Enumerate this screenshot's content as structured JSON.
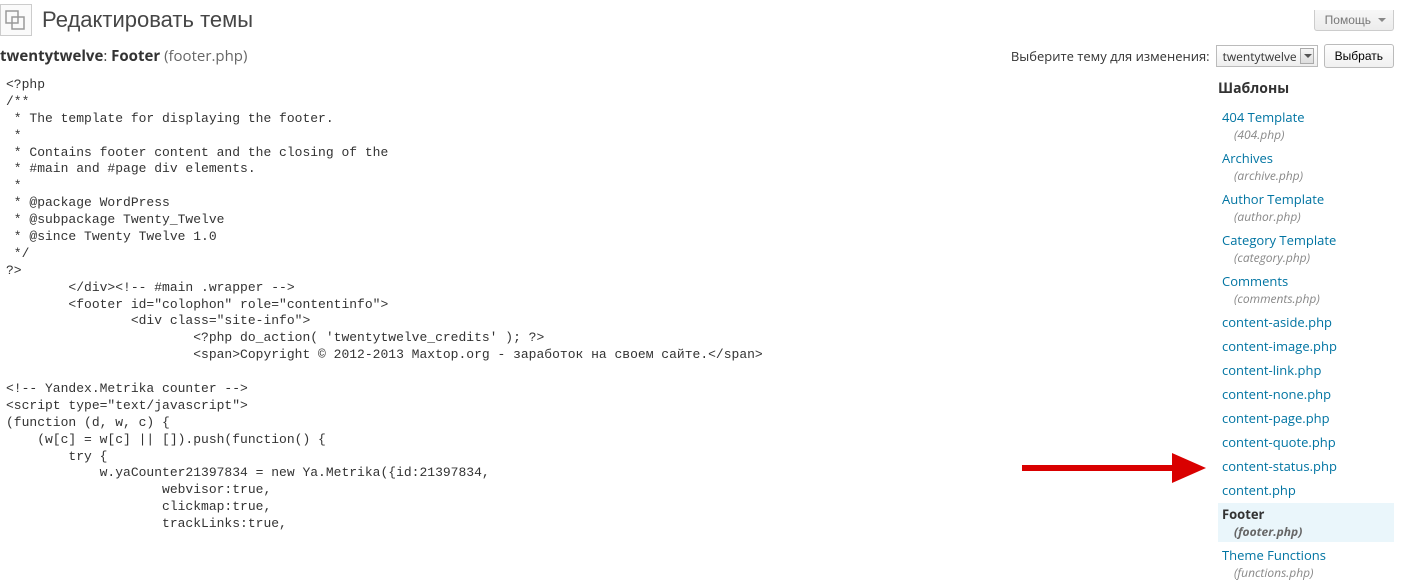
{
  "header": {
    "title": "Редактировать темы",
    "help_label": "Помощь"
  },
  "subheader": {
    "theme_name": "twentytwelve",
    "title_sep": ": ",
    "file_label": "Footer",
    "file_name": "(footer.php)"
  },
  "selector": {
    "label": "Выберите тему для изменения:",
    "selected": "twentytwelve",
    "button": "Выбрать"
  },
  "editor": {
    "content": "<?php\n/**\n * The template for displaying the footer.\n *\n * Contains footer content and the closing of the\n * #main and #page div elements.\n *\n * @package WordPress\n * @subpackage Twenty_Twelve\n * @since Twenty Twelve 1.0\n */\n?>\n        </div><!-- #main .wrapper -->\n        <footer id=\"colophon\" role=\"contentinfo\">\n                <div class=\"site-info\">\n                        <?php do_action( 'twentytwelve_credits' ); ?>\n                        <span>Copyright © 2012-2013 Maxtop.org - заработок на своем сайте.</span>\n\n<!-- Yandex.Metrika counter -->\n<script type=\"text/javascript\">\n(function (d, w, c) {\n    (w[c] = w[c] || []).push(function() {\n        try {\n            w.yaCounter21397834 = new Ya.Metrika({id:21397834,\n                    webvisor:true,\n                    clickmap:true,\n                    trackLinks:true,"
  },
  "sidebar": {
    "heading": "Шаблоны",
    "files": [
      {
        "label": "404 Template",
        "fname": "(404.php)",
        "active": false
      },
      {
        "label": "Archives",
        "fname": "(archive.php)",
        "active": false
      },
      {
        "label": "Author Template",
        "fname": "(author.php)",
        "active": false
      },
      {
        "label": "Category Template",
        "fname": "(category.php)",
        "active": false
      },
      {
        "label": "Comments",
        "fname": "(comments.php)",
        "active": false
      },
      {
        "label": "content-aside.php",
        "fname": "",
        "active": false
      },
      {
        "label": "content-image.php",
        "fname": "",
        "active": false
      },
      {
        "label": "content-link.php",
        "fname": "",
        "active": false
      },
      {
        "label": "content-none.php",
        "fname": "",
        "active": false
      },
      {
        "label": "content-page.php",
        "fname": "",
        "active": false
      },
      {
        "label": "content-quote.php",
        "fname": "",
        "active": false
      },
      {
        "label": "content-status.php",
        "fname": "",
        "active": false
      },
      {
        "label": "content.php",
        "fname": "",
        "active": false
      },
      {
        "label": "Footer",
        "fname": "(footer.php)",
        "active": true
      },
      {
        "label": "Theme Functions",
        "fname": "(functions.php)",
        "active": false
      }
    ]
  }
}
